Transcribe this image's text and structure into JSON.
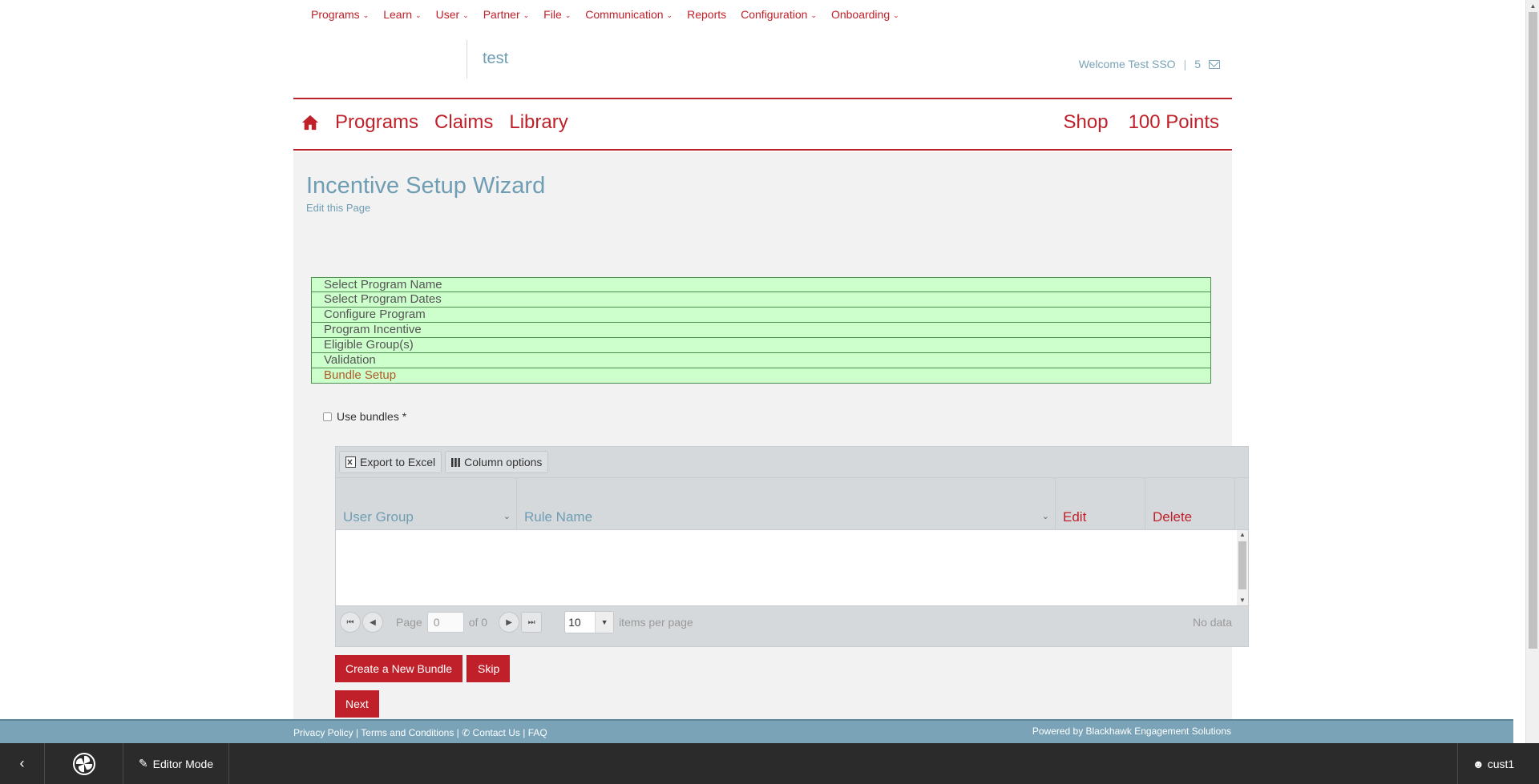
{
  "admin_menu": [
    {
      "label": "Programs",
      "has_dropdown": true
    },
    {
      "label": "Learn",
      "has_dropdown": true
    },
    {
      "label": "User",
      "has_dropdown": true
    },
    {
      "label": "Partner",
      "has_dropdown": true
    },
    {
      "label": "File",
      "has_dropdown": true
    },
    {
      "label": "Communication",
      "has_dropdown": true
    },
    {
      "label": "Reports",
      "has_dropdown": false
    },
    {
      "label": "Configuration",
      "has_dropdown": true
    },
    {
      "label": "Onboarding",
      "has_dropdown": true
    }
  ],
  "header": {
    "site_name": "test",
    "welcome": "Welcome Test SSO",
    "separator": "|",
    "message_count": "5",
    "mail_icon": "envelope-icon"
  },
  "main_nav": {
    "home_icon": "home-icon",
    "left": [
      "Programs",
      "Claims",
      "Library"
    ],
    "shop": "Shop",
    "points": "100 Points"
  },
  "page": {
    "title": "Incentive Setup Wizard",
    "edit_link": "Edit this Page"
  },
  "wizard_steps": [
    {
      "label": "Select Program Name",
      "active": false
    },
    {
      "label": "Select Program Dates",
      "active": false
    },
    {
      "label": "Configure Program",
      "active": false
    },
    {
      "label": "Program Incentive",
      "active": false
    },
    {
      "label": "Eligible Group(s)",
      "active": false
    },
    {
      "label": "Validation",
      "active": false
    },
    {
      "label": "Bundle Setup",
      "active": true
    }
  ],
  "use_bundles": {
    "label": "Use bundles *",
    "checked": false
  },
  "grid": {
    "toolbar": {
      "export": "Export to Excel",
      "columns": "Column options"
    },
    "columns": [
      "User Group",
      "Rule Name",
      "Edit",
      "Delete"
    ],
    "pager": {
      "page_label": "Page",
      "page_value": "0",
      "of_label": "of 0",
      "page_size": "10",
      "items_per_page": "items per page",
      "status": "No data"
    }
  },
  "buttons": {
    "create_bundle": "Create a New Bundle",
    "skip": "Skip",
    "next": "Next"
  },
  "footer": {
    "privacy": "Privacy Policy",
    "terms": "Terms and Conditions",
    "contact": "Contact Us",
    "faq": "FAQ",
    "powered": "Powered by Blackhawk Engagement Solutions"
  },
  "bottom_bar": {
    "editor_mode": "Editor Mode",
    "user": "cust1"
  },
  "colors": {
    "brand_red": "#c0202a",
    "accent_blue": "#6e9db4",
    "wizard_green": "#ccffcc",
    "footer_blue": "#7aa3b8",
    "dark_bar": "#2b2b2b"
  }
}
